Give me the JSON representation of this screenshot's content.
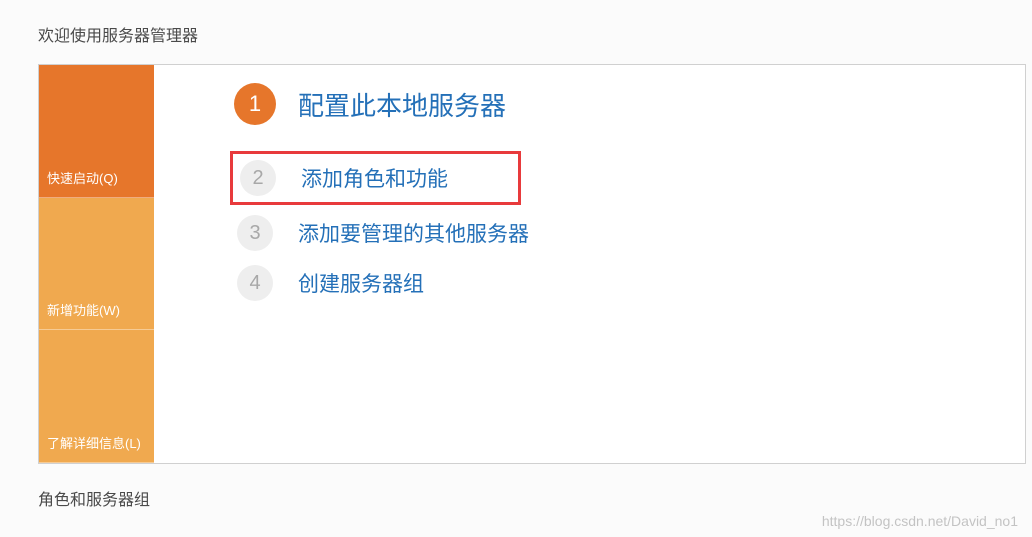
{
  "welcome_title": "欢迎使用服务器管理器",
  "side_tabs": {
    "quick_start": "快速启动(Q)",
    "new_features": "新增功能(W)",
    "learn_more": "了解详细信息(L)"
  },
  "steps": {
    "step1": {
      "num": "1",
      "label": "配置此本地服务器"
    },
    "step2": {
      "num": "2",
      "label": "添加角色和功能"
    },
    "step3": {
      "num": "3",
      "label": "添加要管理的其他服务器"
    },
    "step4": {
      "num": "4",
      "label": "创建服务器组"
    }
  },
  "section_title": "角色和服务器组",
  "watermark": "https://blog.csdn.net/David_no1"
}
